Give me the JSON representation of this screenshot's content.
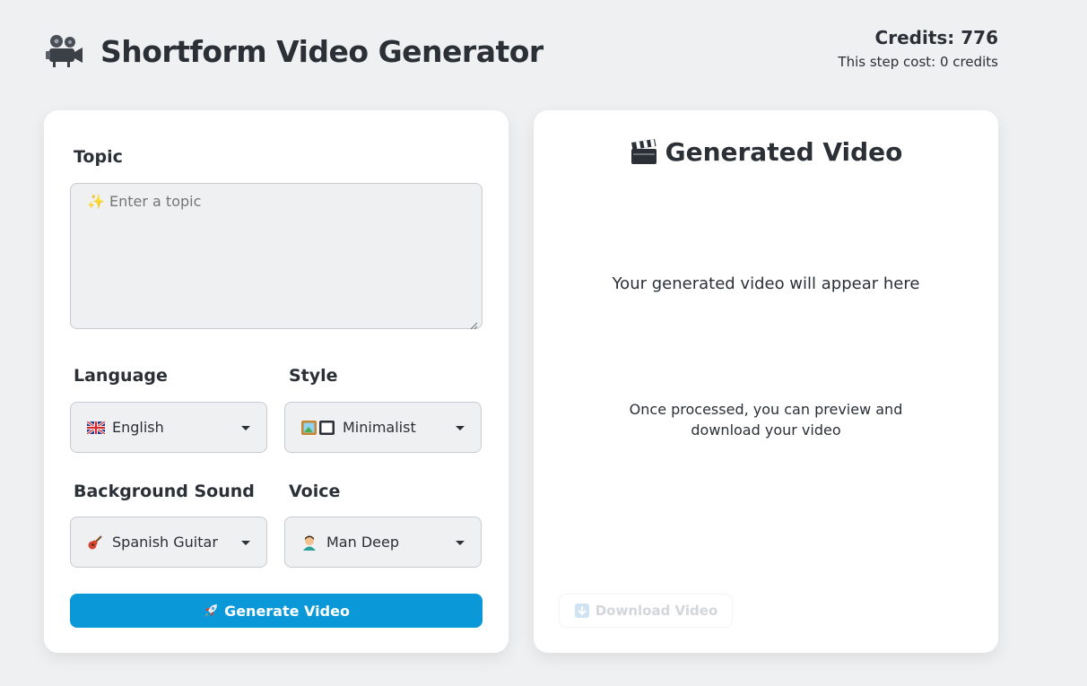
{
  "app": {
    "title": "Shortform Video Generator",
    "title_icon": "movie-camera-icon"
  },
  "credits": {
    "main": "Credits: 776",
    "step_cost": "This step cost: 0 credits"
  },
  "form": {
    "topic_label": "Topic",
    "topic_placeholder": "✨ Enter a topic",
    "topic_value": "",
    "language_label": "Language",
    "language_value": "English",
    "language_icon": "uk-flag-icon",
    "style_label": "Style",
    "style_value": "Minimalist",
    "style_icon": "framed-picture-icon",
    "background_sound_label": "Background Sound",
    "background_sound_value": "Spanish Guitar",
    "background_sound_icon": "guitar-icon",
    "voice_label": "Voice",
    "voice_value": "Man Deep",
    "voice_icon": "man-icon",
    "generate_label": "Generate Video",
    "generate_icon": "rocket-icon"
  },
  "preview": {
    "title": "Generated Video",
    "title_icon": "clapper-board-icon",
    "placeholder": "Your generated video will appear here",
    "hint": "Once processed, you can preview and download your video",
    "download_label": "Download Video",
    "download_icon": "down-arrow-icon"
  },
  "colors": {
    "background": "#eef0f2",
    "card": "#ffffff",
    "primary": "#0a98d8",
    "text": "#2b2f36",
    "disabled_text": "#d3d6da"
  }
}
